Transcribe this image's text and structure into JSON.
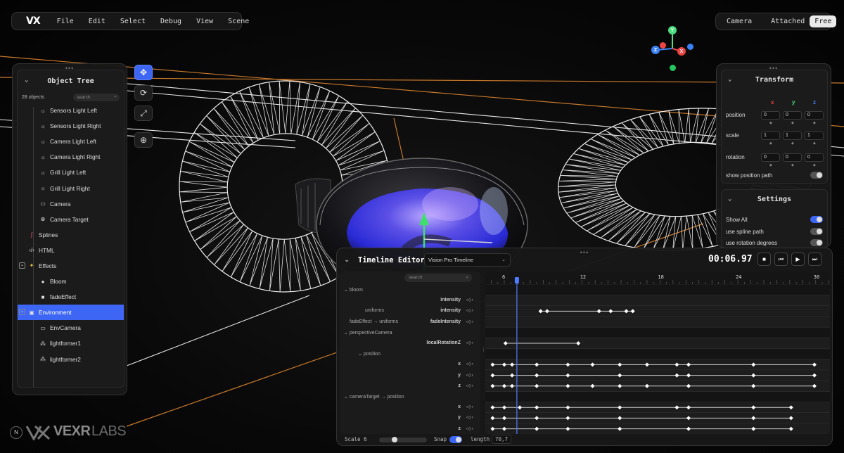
{
  "app": {
    "logo": "VX",
    "menu": [
      "File",
      "Edit",
      "Select",
      "Debug",
      "View",
      "Scene"
    ]
  },
  "camera": {
    "label": "Camera",
    "options": [
      "Attached",
      "Free"
    ],
    "selected": "Free"
  },
  "gizmo": {
    "axes": [
      {
        "label": "Y",
        "color": "#4ade80"
      },
      {
        "label": "Z",
        "color": "#3b82f6"
      },
      {
        "label": "X",
        "color": "#ef4444"
      }
    ]
  },
  "object_tree": {
    "title": "Object Tree",
    "count": "28 objects",
    "search_placeholder": "search",
    "items": [
      {
        "label": "Sensors Light Left",
        "icon": "light-icon",
        "level": 2
      },
      {
        "label": "Sensors Light Right",
        "icon": "light-icon",
        "level": 2
      },
      {
        "label": "Camera Light Left",
        "icon": "light-icon",
        "level": 2
      },
      {
        "label": "Camera Light Right",
        "icon": "light-icon",
        "level": 2
      },
      {
        "label": "Grill Light Left",
        "icon": "light-icon",
        "level": 2
      },
      {
        "label": "Grill Light Right",
        "icon": "light-icon",
        "level": 2
      },
      {
        "label": "Camera",
        "icon": "camera-icon",
        "level": 2
      },
      {
        "label": "Camera Target",
        "icon": "target-icon",
        "level": 2
      },
      {
        "label": "Splines",
        "icon": "spline-icon",
        "level": 1
      },
      {
        "label": "HTML",
        "icon": "code-icon",
        "level": 1
      },
      {
        "label": "Effects",
        "icon": "sparkle-icon",
        "level": 1,
        "checkbox": true
      },
      {
        "label": "Bloom",
        "icon": "bloom-icon",
        "level": 2
      },
      {
        "label": "fadeEffect",
        "icon": "fade-icon",
        "level": 2
      },
      {
        "label": "Environment",
        "icon": "environment-icon",
        "level": 1,
        "checkbox": true,
        "selected": true
      },
      {
        "label": "EnvCamera",
        "icon": "camera-icon",
        "level": 2
      },
      {
        "label": "lightformer1",
        "icon": "lightformer-icon",
        "level": 2
      },
      {
        "label": "lightformer2",
        "icon": "lightformer-icon",
        "level": 2
      }
    ]
  },
  "tools": [
    "move-icon",
    "rotate-icon",
    "scale-icon",
    "globe-icon"
  ],
  "transform": {
    "title": "Transform",
    "axes": [
      "x",
      "y",
      "z"
    ],
    "props": [
      {
        "label": "position",
        "values": [
          "0",
          "0",
          "0"
        ]
      },
      {
        "label": "scale",
        "values": [
          "1",
          "1",
          "1"
        ]
      },
      {
        "label": "rotation",
        "values": [
          "0",
          "0",
          "0"
        ]
      }
    ],
    "show_position_path": "show position path"
  },
  "settings": {
    "title": "Settings",
    "items": [
      {
        "label": "Show All",
        "on": true
      },
      {
        "label": "use spline path",
        "on": false
      },
      {
        "label": "use rotation degrees",
        "on": false
      }
    ]
  },
  "timeline": {
    "title": "Timeline Editor",
    "selected_timeline": "Vision Pro Timeline",
    "time": "00:06.97",
    "search_placeholder": "search",
    "ticks": [
      "6",
      "12",
      "18",
      "24",
      "30"
    ],
    "rows": [
      {
        "group": "bloom"
      },
      {
        "prop": "intensity",
        "keys": []
      },
      {
        "label": "uniforms",
        "prop": "intensity",
        "keys": [
          8.8,
          9.3,
          13.3,
          14.2,
          15.4,
          15.9
        ]
      },
      {
        "label": "fadeEffect → uniforms",
        "prop": "fadeIntensity",
        "keys": []
      },
      {
        "group": "perspectiveCamera"
      },
      {
        "prop": "localRotationZ",
        "keys": [
          6.1,
          11.7
        ]
      },
      {
        "sub": "position"
      },
      {
        "prop": "x",
        "keys": [
          5.1,
          6.0,
          6.6,
          8.5,
          10.9,
          12.8,
          14.9,
          17.0,
          19.3,
          20.2,
          25.2,
          29.9
        ]
      },
      {
        "prop": "y",
        "keys": [
          5.1,
          6.6,
          8.5,
          10.9,
          14.9,
          19.3,
          20.2,
          25.2,
          29.9
        ]
      },
      {
        "prop": "z",
        "keys": [
          5.1,
          6.0,
          6.6,
          8.5,
          10.9,
          12.8,
          14.9,
          17.0,
          20.2,
          25.2,
          29.9
        ]
      },
      {
        "group": "cameraTarget → position"
      },
      {
        "prop": "x",
        "keys": [
          5.1,
          6.0,
          7.2,
          8.5,
          10.9,
          14.9,
          19.3,
          20.2,
          25.2,
          28.1
        ]
      },
      {
        "prop": "y",
        "keys": [
          5.1,
          6.0,
          8.5,
          10.9,
          14.9,
          20.2,
          25.2,
          28.1
        ]
      },
      {
        "prop": "z",
        "keys": [
          5.1,
          6.0,
          8.5,
          10.9,
          14.9,
          20.2,
          25.2,
          28.1
        ]
      }
    ],
    "scale_label": "Scale 6",
    "scale_value": 0.3,
    "snap_label": "Snap",
    "length_label": "length",
    "length_value": "70,7"
  },
  "brand": {
    "badge": "N",
    "name_bold": "VEXR",
    "name_light": "LABS"
  },
  "colors": {
    "accent": "#3d66f5",
    "orange_line": "#c8782a",
    "visor": "#2a2bd6"
  }
}
